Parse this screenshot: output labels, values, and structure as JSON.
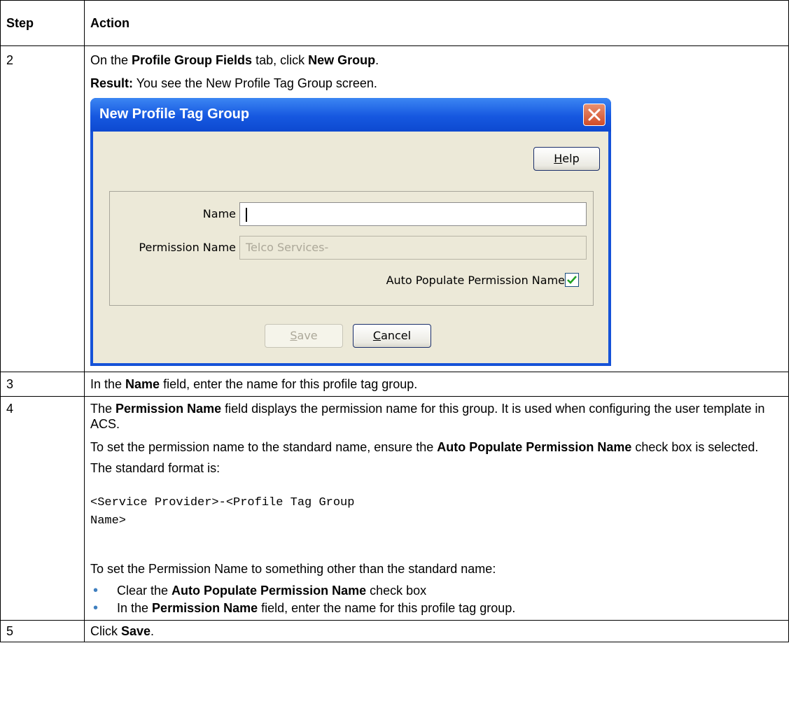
{
  "table": {
    "headers": {
      "step": "Step",
      "action": "Action"
    },
    "rows": {
      "r2": {
        "step": "2",
        "l1_pre": "On the ",
        "l1_b1": "Profile Group Fields",
        "l1_mid": " tab, click ",
        "l1_b2": "New Group",
        "l1_post": ".",
        "l2_b": "Result:",
        "l2_post": " You see the New Profile Tag Group screen."
      },
      "r3": {
        "step": "3",
        "pre": "In the ",
        "b": "Name",
        "post": " field, enter the name for this profile tag group."
      },
      "r4": {
        "step": "4",
        "p1_pre": "The ",
        "p1_b": "Permission Name",
        "p1_post": " field displays the permission name for this group. It is used when configuring the user template in ACS.",
        "p2_pre": "To set the permission name to the standard name, ensure the ",
        "p2_b": "Auto Populate Permission Name",
        "p2_post": " check box is selected.",
        "p3": "The standard format is:",
        "code": "<Service Provider>-<Profile Tag Group\nName>",
        "p4": "To set the Permission Name to something other than the standard name:",
        "b1_pre": "Clear the ",
        "b1_b": "Auto Populate Permission Name",
        "b1_post": " check box",
        "b2_pre": "In the ",
        "b2_b": "Permission Name",
        "b2_post": " field, enter the name for this profile tag group."
      },
      "r5": {
        "step": "5",
        "pre": "Click ",
        "b": "Save",
        "post": "."
      }
    }
  },
  "dialog": {
    "title": "New Profile Tag Group",
    "help_h": "H",
    "help_rest": "elp",
    "name_label": "Name",
    "name_value": "",
    "permission_label": "Permission Name",
    "permission_value": "Telco Services-",
    "auto_populate_label": "Auto Populate Permission Name",
    "auto_populate_checked": true,
    "save_s": "S",
    "save_rest": "ave",
    "cancel_c": "C",
    "cancel_rest": "ancel",
    "colors": {
      "title_blue": "#1552d8",
      "body": "#ece9d8",
      "close_red": "#d04c28",
      "check_green": "#21a121"
    }
  }
}
